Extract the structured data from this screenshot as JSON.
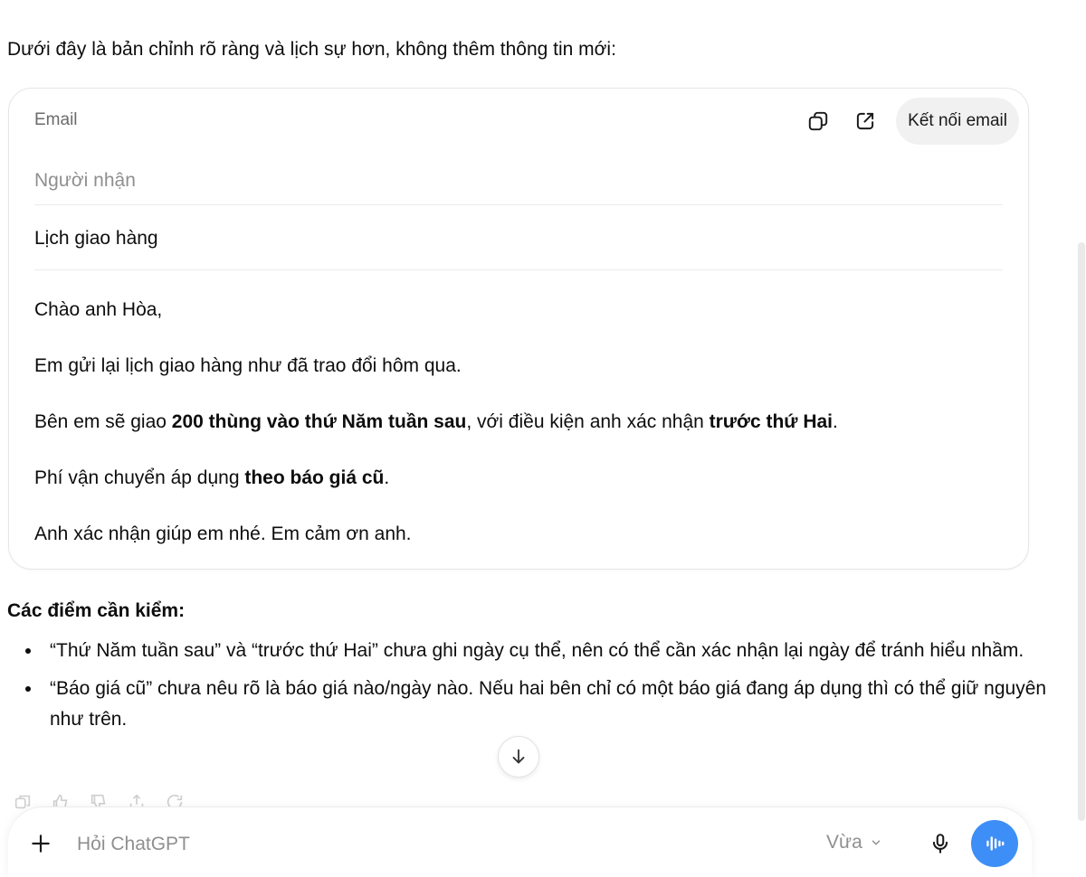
{
  "intro": "Dưới đây là bản chỉnh rõ ràng và lịch sự hơn, không thêm thông tin mới:",
  "email_card": {
    "label": "Email",
    "connect_label": "Kết nối email",
    "recipient_placeholder": "Người nhận",
    "subject": "Lịch giao hàng",
    "greeting": "Chào anh Hòa,",
    "line1": "Em gửi lại lịch giao hàng như đã trao đổi hôm qua.",
    "line2_a": "Bên em sẽ giao ",
    "line2_b": "200 thùng vào thứ Năm tuần sau",
    "line2_c": ", với điều kiện anh xác nhận ",
    "line2_d": "trước thứ Hai",
    "line2_e": ".",
    "line3_a": "Phí vận chuyển áp dụng ",
    "line3_b": "theo báo giá cũ",
    "line3_c": ".",
    "line4": "Anh xác nhận giúp em nhé. Em cảm ơn anh."
  },
  "checks": {
    "heading": "Các điểm cần kiểm:",
    "items": [
      "“Thứ Năm tuần sau” và “trước thứ Hai” chưa ghi ngày cụ thể, nên có thể cần xác nhận lại ngày để tránh hiểu nhầm.",
      "“Báo giá cũ” chưa nêu rõ là báo giá nào/ngày nào. Nếu hai bên chỉ có một báo giá đang áp dụng thì có thể giữ nguyên như trên."
    ]
  },
  "composer": {
    "placeholder": "Hỏi ChatGPT",
    "mode": "Vừa"
  },
  "icons": {
    "copy": "copy-icon",
    "open": "open-external-icon",
    "scroll": "arrow-down-icon",
    "plus": "plus-icon",
    "chevron": "chevron-down-icon",
    "mic": "microphone-icon",
    "voice": "voice-waveform-icon"
  },
  "colors": {
    "accent": "#3e8ef7",
    "muted_text": "#8f8f8f",
    "pill_bg": "#f1f1f1"
  }
}
